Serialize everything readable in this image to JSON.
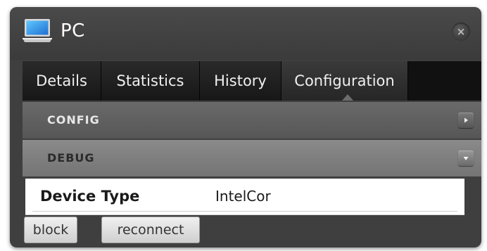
{
  "window": {
    "title": "PC",
    "icon": "laptop-icon",
    "close_icon": "close-icon",
    "close_glyph": "×"
  },
  "tabs": [
    {
      "label": "Details",
      "active": false
    },
    {
      "label": "Statistics",
      "active": false
    },
    {
      "label": "History",
      "active": false
    },
    {
      "label": "Configuration",
      "active": true
    }
  ],
  "sections": {
    "config": {
      "label": "CONFIG",
      "state": "collapsed",
      "toggle_icon": "chevron-right-icon"
    },
    "debug": {
      "label": "DEBUG",
      "state": "expanded",
      "toggle_icon": "chevron-down-icon"
    }
  },
  "debug_fields": [
    {
      "label": "Device Type",
      "value": "IntelCor"
    }
  ],
  "actions": {
    "block_label": "block",
    "reconnect_label": "reconnect"
  },
  "colors": {
    "panel_bg": "#3f3f3f",
    "tab_bg": "#171717",
    "config_bar": "#5f5f5f",
    "debug_bar": "#7f7f7f"
  }
}
